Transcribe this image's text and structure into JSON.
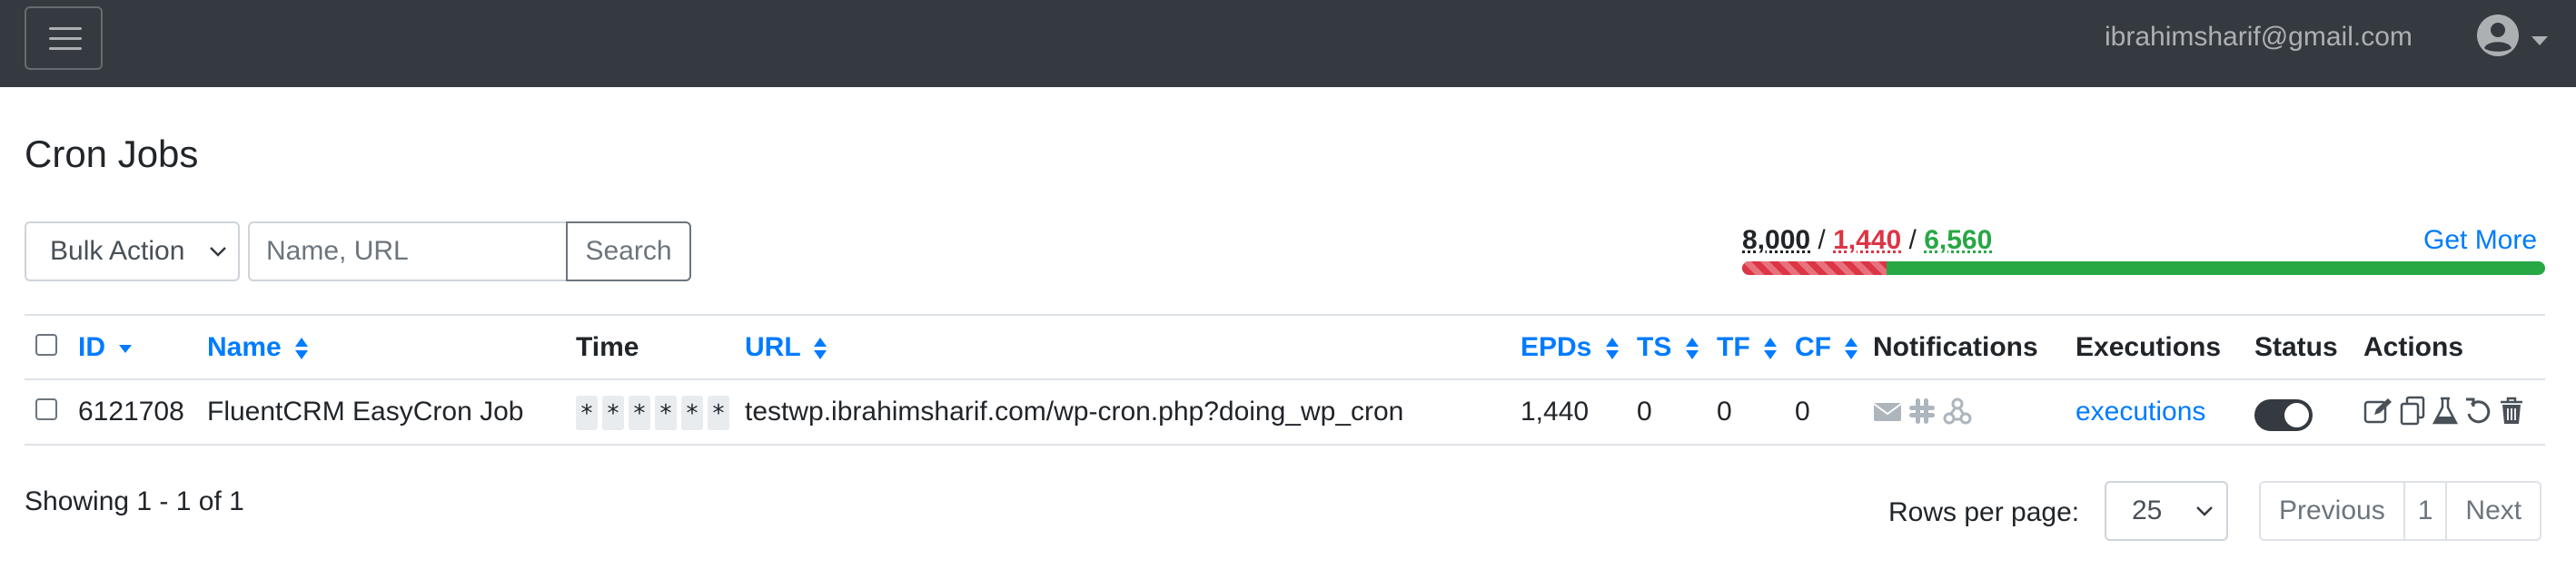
{
  "header": {
    "user_email": "ibrahimsharif@gmail.com"
  },
  "page": {
    "title": "Cron Jobs"
  },
  "toolbar": {
    "bulk_action_label": "Bulk Action",
    "search_placeholder": "Name, URL",
    "search_button": "Search"
  },
  "quota": {
    "total": "8,000",
    "used": "1,440",
    "remaining": "6,560",
    "separator": "/",
    "used_fraction": 0.18,
    "get_more": "Get More"
  },
  "table": {
    "headers": {
      "id": "ID",
      "name": "Name",
      "time": "Time",
      "url": "URL",
      "epds": "EPDs",
      "ts": "TS",
      "tf": "TF",
      "cf": "CF",
      "notifications": "Notifications",
      "executions": "Executions",
      "status": "Status",
      "actions": "Actions"
    },
    "rows": [
      {
        "id": "6121708",
        "name": "FluentCRM EasyCron Job",
        "time": [
          "*",
          "*",
          "*",
          "*",
          "*",
          "*"
        ],
        "url": "testwp.ibrahimsharif.com/wp-cron.php?doing_wp_cron",
        "epds": "1,440",
        "ts": "0",
        "tf": "0",
        "cf": "0",
        "notifications": [
          "email-icon",
          "slack-icon",
          "webhook-icon"
        ],
        "executions": "executions",
        "status": true,
        "actions": [
          "edit-icon",
          "copy-icon",
          "test-icon",
          "undo-icon",
          "delete-icon"
        ]
      }
    ]
  },
  "footer": {
    "showing": "Showing 1 - 1 of 1",
    "rows_per_page_label": "Rows per page:",
    "rows_per_page_value": "25",
    "previous": "Previous",
    "page": "1",
    "next": "Next"
  },
  "colors": {
    "navbar": "#343a40",
    "link": "#007bff",
    "danger": "#dc3545",
    "success": "#28a745"
  }
}
